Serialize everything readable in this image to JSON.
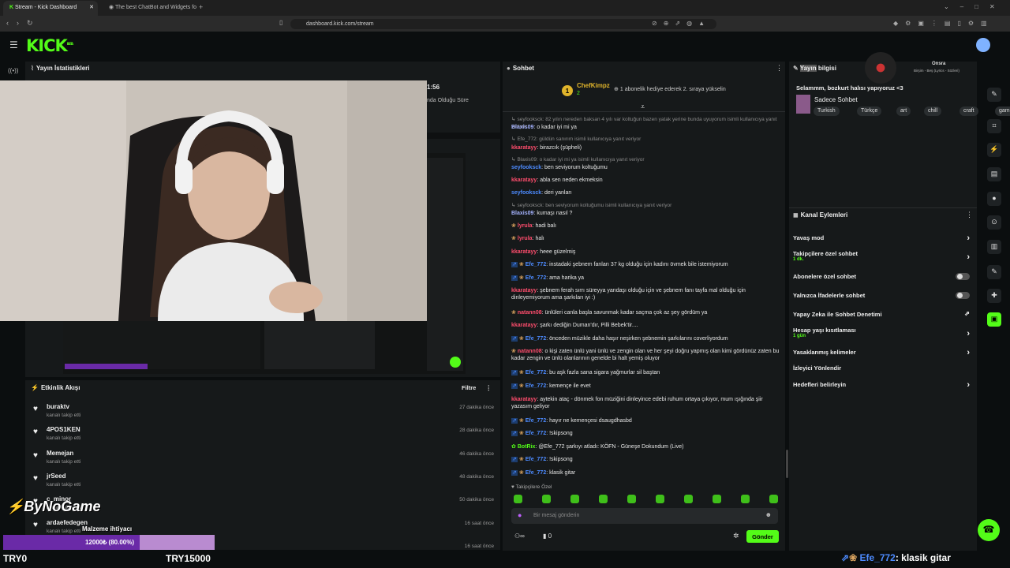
{
  "browser": {
    "tabs": [
      {
        "label": "Stream - Kick Dashboard",
        "active": true
      },
      {
        "label": "The best ChatBot and Widgets fo",
        "active": false
      }
    ],
    "url": "dashboard.kick.com/stream"
  },
  "app": {
    "logo": "KICK",
    "logo_badge": "BETA"
  },
  "stats": {
    "title": "Yayın İstatistikleri",
    "time_partial": "1:56",
    "partial_label": "nda Olduğu Süre"
  },
  "activity": {
    "title": "Etkinlik Akışı",
    "filter_label": "Filtre",
    "items": [
      {
        "name": "buraktv",
        "sub": "kanalı takip etti",
        "time": "27 dakika önce"
      },
      {
        "name": "4POS1KEN",
        "sub": "kanalı takip etti",
        "time": "28 dakika önce"
      },
      {
        "name": "Memejan",
        "sub": "kanalı takip etti",
        "time": "46 dakika önce"
      },
      {
        "name": "jrSeed",
        "sub": "kanalı takip etti",
        "time": "48 dakika önce"
      },
      {
        "name": "c_minor",
        "sub": "kanalı takip etti",
        "time": "50 dakika önce"
      },
      {
        "name": "ardaefedegen",
        "sub": "kanalı takip etti",
        "time": "16 saat önce"
      },
      {
        "name": "",
        "sub": "",
        "time": "16 saat önce"
      }
    ]
  },
  "overlay": {
    "watermark": "ByNoGame",
    "goal_label": "Malzeme ihtiyacı",
    "goal_progress_text": "12000₺ (80.00%)",
    "goal_progress": 0.8,
    "goal_min": "TRY0",
    "goal_max": "TRY15000"
  },
  "chat": {
    "title": "Sohbet",
    "pinned_user": "ChefKimpz",
    "pinned_count": "2",
    "pinned_text": "1 abonelik hediye ederek 2. sıraya yükselin",
    "messages": [
      {
        "type": "reply",
        "text": "seyfooksck: 82 yılın nereden baksan 4 yılı var koltuğun bazen yatak yerine bunda uyuyorum isimli kullanıcıya yanıt veriyor"
      },
      {
        "user": "Blaxis09",
        "color": "#a5b3ff",
        "text": "o kadar iyi mi ya"
      },
      {
        "type": "reply",
        "text": "Efe_772: güldün sanırım isimli kullanıcıya yanıt veriyor"
      },
      {
        "user": "kkaratayy",
        "color": "#ff4d6d",
        "text": "birazcık (şüpheli)"
      },
      {
        "type": "reply",
        "text": "Blaxis09: o kadar iyi mi ya isimli kullanıcıya yanıt veriyor"
      },
      {
        "user": "seyfooksck",
        "color": "#4d8bff",
        "text": "ben seviyorum koltuğumu"
      },
      {
        "user": "kkaratayy",
        "color": "#ff4d6d",
        "text": "abla sen neden ekmeksin"
      },
      {
        "user": "seyfooksck",
        "color": "#4d8bff",
        "text": "deri yanları"
      },
      {
        "type": "reply",
        "text": "seyfooksck: ben seviyorum koltuğumu isimli kullanıcıya yanıt veriyor"
      },
      {
        "user": "Blaxis09",
        "color": "#a5b3ff",
        "text": "kumaşı nasıl ?"
      },
      {
        "user": "lyrula",
        "color": "#ff4d6d",
        "text": "hadi balı",
        "badge": true
      },
      {
        "user": "lyrula",
        "color": "#ff4d6d",
        "text": "halı",
        "badge": true
      },
      {
        "user": "kkaratayy",
        "color": "#ff4d6d",
        "text": "heee güzelmiş"
      },
      {
        "user": "Efe_772",
        "color": "#4d8bff",
        "text": "instadaki şebnem fanları 37 kg olduğu için kadını övmek bile istemiyorum",
        "badge2": true
      },
      {
        "user": "Efe_772",
        "color": "#4d8bff",
        "text": "ama harika ya",
        "badge2": true
      },
      {
        "user": "kkaratayy",
        "color": "#ff4d6d",
        "text": "şebnem ferah sırrı süreyya yandaşı olduğu için ve şebnem fanı tayfa mal olduğu için dinleyemiyorum ama şarkıları iyi :)"
      },
      {
        "user": "natann08",
        "color": "#ff4d6d",
        "text": "ünlüleri canla başla savunmak kadar saçma çok az şey gördüm ya",
        "badge": true
      },
      {
        "user": "kkaratayy",
        "color": "#ff4d6d",
        "text": "şarkı dediğin Duman'dır, Pilli Bebek'tir...."
      },
      {
        "user": "Efe_772",
        "color": "#4d8bff",
        "text": "önceden müzikle daha haşır neşirken şebnemin şarkılarını coverliyordum",
        "badge2": true
      },
      {
        "user": "natann08",
        "color": "#ff4d6d",
        "text": "o kişi zaten ünlü yani ünlü ve zengin olan ve her şeyi doğru yapmış olan kimi gördünüz zaten bu kadar zengin ve ünlü olanlarının genelde bi halt yemiş oluyor",
        "badge": true
      },
      {
        "user": "Efe_772",
        "color": "#4d8bff",
        "text": "bu aşk fazla sana sigara yağmurlar sil baştan",
        "badge2": true
      },
      {
        "user": "Efe_772",
        "color": "#4d8bff",
        "text": "kemençe ile evet",
        "badge2": true
      },
      {
        "user": "kkaratayy",
        "color": "#ff4d6d",
        "text": "aytekin ataç - dönmek fon müziğini dinleyince edebi ruhum ortaya çıkıyor, mum ışığında şiir yazasım geliyor"
      },
      {
        "user": "Efe_772",
        "color": "#4d8bff",
        "text": "hayır ne kemençesi dsaugdhasbd",
        "badge2": true
      },
      {
        "user": "Efe_772",
        "color": "#4d8bff",
        "text": "!skipsong",
        "badge2": true
      },
      {
        "user": "BotRix",
        "color": "#53fc18",
        "text": "@Efe_772 şarkıyı atladı: KÖFN - Güneşe Dokundum (Live)",
        "bot": true
      },
      {
        "user": "Efe_772",
        "color": "#4d8bff",
        "text": "!skipsong",
        "badge2": true
      },
      {
        "user": "Efe_772",
        "color": "#4d8bff",
        "text": "klasik gitar",
        "badge2": true
      }
    ],
    "followers_only": "Takipçilere Özel",
    "input_placeholder": "Bir mesaj gönderin",
    "viewer_count": "0",
    "send_label": "Gönder"
  },
  "info": {
    "title_part1": "Yayın",
    "title_part2": " bilgisi",
    "stream_title": "Selammm, bozkurt halısı yapıyoruz <3",
    "category": "Sadece Sohbet",
    "tags": [
      "Turkish",
      "Türkçe",
      "art",
      "chill",
      "craft",
      "game"
    ],
    "now_playing_title": "Onsra",
    "now_playing_sub": "Birşim - Beş (Lyrics - Sözleri)"
  },
  "actions": {
    "title": "Kanal Eylemleri",
    "items": [
      {
        "label": "Yavaş mod",
        "control": "chevron"
      },
      {
        "label": "Takipçilere özel sohbet",
        "sub": "1 dk.",
        "control": "chevron"
      },
      {
        "label": "Abonelere özel sohbet",
        "control": "toggle"
      },
      {
        "label": "Yalnızca İfadelerle sohbet",
        "control": "toggle"
      },
      {
        "label": "Yapay Zeka ile Sohbet Denetimi",
        "control": "ext"
      },
      {
        "label": "Hesap yaşı kısıtlaması",
        "sub": "1 gün",
        "control": "chevron"
      },
      {
        "label": "Yasaklanmış kelimeler",
        "control": "chevron"
      },
      {
        "label": "İzleyici Yönlendir",
        "control": "none"
      },
      {
        "label": "Hedefleri belirleyin",
        "control": "chevron"
      }
    ]
  },
  "ticker": {
    "user": "Efe_772",
    "text": ": klasik gitar"
  },
  "colors": {
    "accent": "#53fc18",
    "panel": "#16191a",
    "bg": "#0b0e0f"
  }
}
